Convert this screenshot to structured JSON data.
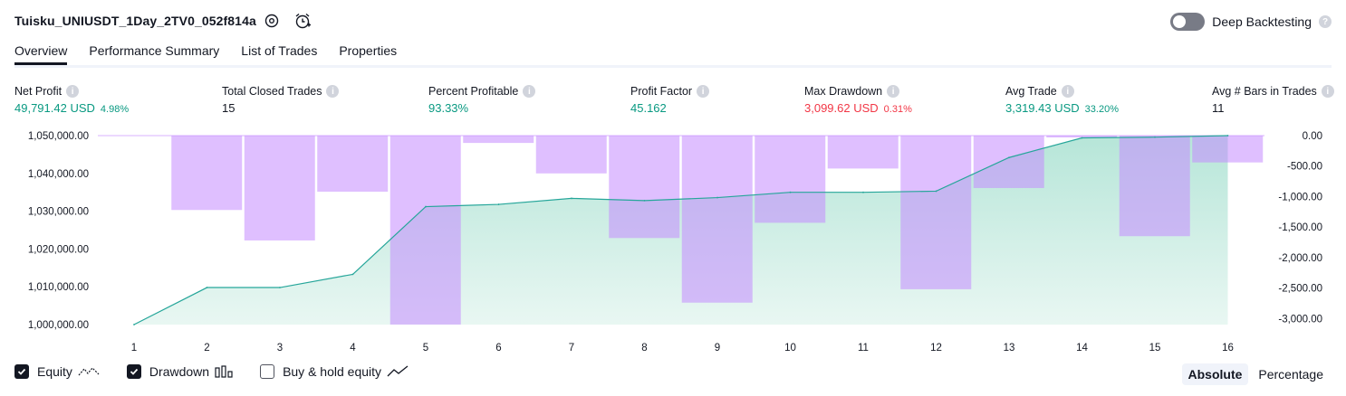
{
  "header": {
    "title": "Tuisku_UNIUSDT_1Day_2TV0_052f814a",
    "deep_backtesting_label": "Deep Backtesting"
  },
  "tabs": [
    "Overview",
    "Performance Summary",
    "List of Trades",
    "Properties"
  ],
  "metrics": [
    {
      "label": "Net Profit",
      "value": "49,791.42 USD",
      "sub": "4.98%",
      "color": "#089981"
    },
    {
      "label": "Total Closed Trades",
      "value": "15",
      "sub": "",
      "color": "#131722"
    },
    {
      "label": "Percent Profitable",
      "value": "93.33%",
      "sub": "",
      "color": "#089981"
    },
    {
      "label": "Profit Factor",
      "value": "45.162",
      "sub": "",
      "color": "#089981"
    },
    {
      "label": "Max Drawdown",
      "value": "3,099.62 USD",
      "sub": "0.31%",
      "color": "#f23645"
    },
    {
      "label": "Avg Trade",
      "value": "3,319.43 USD",
      "sub": "33.20%",
      "color": "#089981"
    },
    {
      "label": "Avg # Bars in Trades",
      "value": "11",
      "sub": "",
      "color": "#131722"
    }
  ],
  "legend": {
    "equity": "Equity",
    "drawdown": "Drawdown",
    "buy_hold": "Buy & hold equity",
    "absolute": "Absolute",
    "percentage": "Percentage"
  },
  "chart_data": {
    "type": "area",
    "x": [
      1,
      2,
      3,
      4,
      5,
      6,
      7,
      8,
      9,
      10,
      11,
      12,
      13,
      14,
      15,
      16
    ],
    "y_left_ticks": [
      "1,050,000.00",
      "1,040,000.00",
      "1,030,000.00",
      "1,020,000.00",
      "1,010,000.00",
      "1,000,000.00"
    ],
    "y_right_ticks": [
      "0.00",
      "-500.00",
      "-1,000.00",
      "-1,500.00",
      "-2,000.00",
      "-2,500.00",
      "-3,000.00"
    ],
    "ylim_left": [
      1000000,
      1050000
    ],
    "ylim_right": [
      -3100,
      0
    ],
    "series": [
      {
        "name": "Equity",
        "color": "#26a69a",
        "values": [
          1000000,
          1009800,
          1009800,
          1013300,
          1031200,
          1031800,
          1033400,
          1032800,
          1033600,
          1035000,
          1035000,
          1035300,
          1044200,
          1049400,
          1049600,
          1050000
        ]
      },
      {
        "name": "Drawdown",
        "color": "#d9b3ff",
        "values": [
          0,
          -1220,
          -1720,
          -920,
          -3099.62,
          -120,
          -620,
          -1680,
          -2740,
          -1430,
          -540,
          -2520,
          -860,
          -30,
          -1650,
          -440
        ]
      }
    ]
  }
}
